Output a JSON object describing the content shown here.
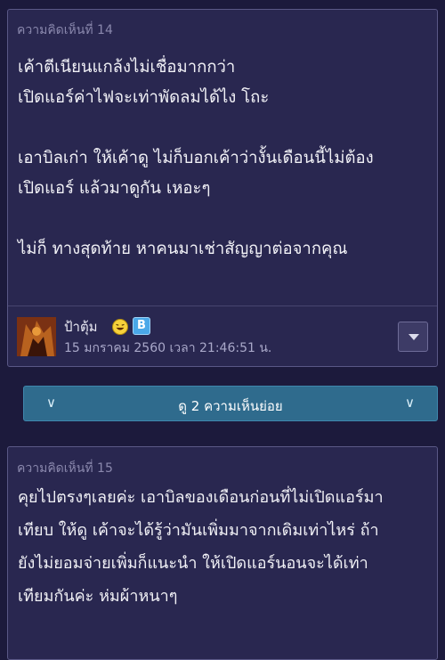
{
  "comment14": {
    "title": "ความคิดเห็นที่ 14",
    "lines": [
      "เค้าตีเนียนแกล้งไม่เชื่อมากกว่า",
      "เปิดแอร์ค่าไฟจะเท่าพัดลมได้ไง โถะ",
      "",
      "เอาบิลเก่า ให้เค้าดู ไม่ก็บอกเค้าว่างั้นเดือนนี้ไม่ต้อง",
      "เปิดแอร์ แล้วมาดูกัน เหอะๆ",
      "",
      "ไม่ก็ ทางสุดท้าย หาคนมาเช่าสัญญาต่อจากคุณ"
    ],
    "author": "ป้าตุ้ม",
    "author_badges": [
      "emoji-laugh-icon",
      "b-badge-icon"
    ],
    "badge_b": "B",
    "date": "15 มกราคม 2560 เวลา 21:46:51 น."
  },
  "subcomments": {
    "label": "ดู 2 ความเห็นย่อย",
    "chevron": "∨"
  },
  "comment15": {
    "title": "ความคิดเห็นที่ 15",
    "lines": [
      "คุยไปตรงๆเลยค่ะ เอาบิลของเดือนก่อนที่ไม่เปิดแอร์มา",
      "เทียบ ให้ดู เค้าจะได้รู้ว่ามันเพิ่มมาจากเดิมเท่าไหร่ ถ้า",
      "ยังไม่ยอมจ่ายเพิ่มก็แนะนำ ให้เปิดแอร์นอนจะได้เท่า",
      "เทียมกันค่ะ ห่มผ้าหนาๆ"
    ]
  },
  "colors": {
    "background": "#1c1a3c",
    "card": "#292750",
    "subcomments_bar": "#2f6b8d"
  }
}
